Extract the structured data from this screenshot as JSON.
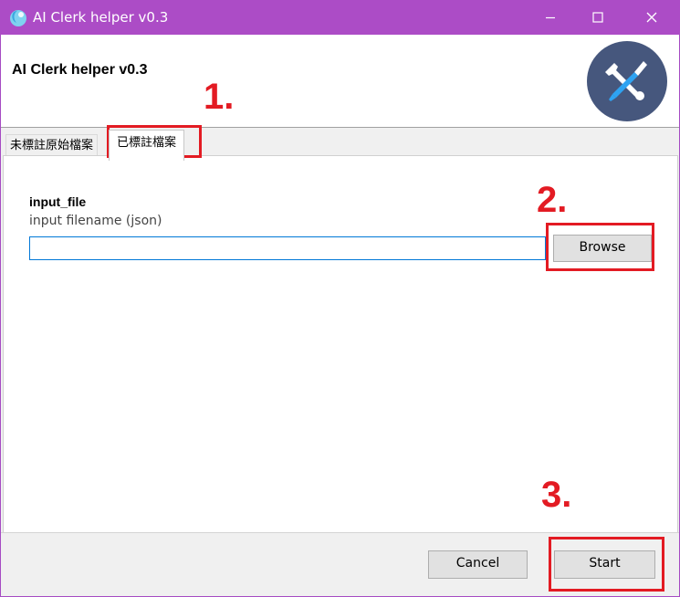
{
  "window": {
    "title": "AI Clerk helper v0.3",
    "titlebar_color": "#ac4cc6",
    "controls": [
      "minimize-icon",
      "maximize-icon",
      "close-icon"
    ]
  },
  "header": {
    "title": "AI Clerk helper v0.3",
    "icon": "wrench-screwdriver-icon",
    "icon_bg": "#46577d"
  },
  "tabs": [
    {
      "label": "未標註原始檔案",
      "active": false
    },
    {
      "label": "已標註檔案",
      "active": true
    }
  ],
  "form": {
    "field_label": "input_file",
    "field_help": "input filename (json)",
    "input_value": "",
    "browse_label": "Browse"
  },
  "footer": {
    "cancel_label": "Cancel",
    "start_label": "Start"
  },
  "annotations": [
    {
      "label": "1.",
      "target": "tab-annotated-files"
    },
    {
      "label": "2.",
      "target": "browse-button"
    },
    {
      "label": "3.",
      "target": "start-button"
    }
  ],
  "annotation_color": "#e31b23"
}
